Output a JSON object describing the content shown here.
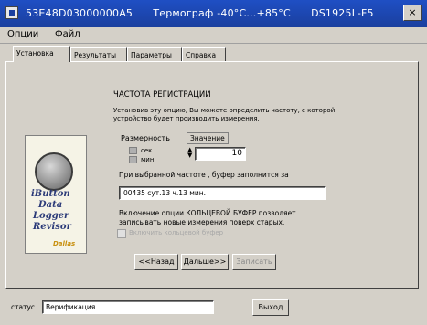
{
  "window": {
    "serial": "53E48D03000000A5",
    "product": "Термограф -40°C...+85°C",
    "model": "DS1925L-F5",
    "close_label": "×"
  },
  "menu": {
    "items": [
      "Опции",
      "Файл"
    ]
  },
  "tabs": [
    {
      "label": "Установка",
      "active": true
    },
    {
      "label": "Результаты",
      "active": false
    },
    {
      "label": "Параметры",
      "active": false
    },
    {
      "label": "Справка",
      "active": false
    }
  ],
  "image": {
    "lines": [
      "iButton",
      "Data",
      "Logger",
      "Revisor"
    ],
    "brand": "Dallas"
  },
  "setup": {
    "heading": "ЧАСТОТА РЕГИСТРАЦИИ",
    "desc_line1": "Установив эту опцию, Вы можете определить частоту, с которой",
    "desc_line2": "устройство будет производить измерения.",
    "dimension_label": "Размерность",
    "value_label": "Значение",
    "unit_sec": "сек.",
    "unit_min": "мин.",
    "rate_value": "10",
    "fill_label": "При выбранной частоте , буфер заполнится за",
    "fill_value": "00435 сут.13 ч.13 мин.",
    "ring_line1": "Включение опции КОЛЬЦЕВОЙ БУФЕР позволяет",
    "ring_line2": "записывать новые измерения поверх старых.",
    "ring_checkbox_label": "Включить кольцевой буфер",
    "ring_checked": false
  },
  "buttons": {
    "back": "<<Назад",
    "next": "Дальше>>",
    "finish": "Записать",
    "exit": "Выход"
  },
  "status": {
    "label": "статус",
    "value": "Верификация..."
  },
  "colors": {
    "titlebar": "#1f4fc4",
    "face": "#d4d0c8"
  }
}
